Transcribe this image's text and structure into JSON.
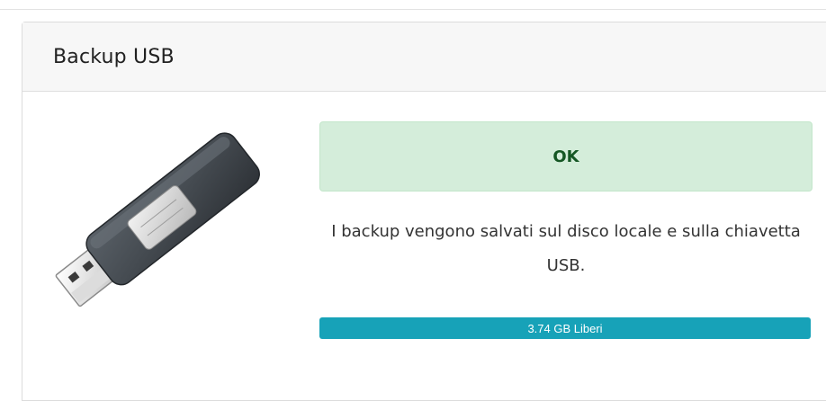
{
  "card": {
    "title": "Backup USB"
  },
  "device": {
    "icon": "usb-drive-icon"
  },
  "status": {
    "text": "OK",
    "color": "#d4edda",
    "text_color": "#155724"
  },
  "description": "I backup vengono salvati sul disco locale e sulla chiavetta USB.",
  "storage": {
    "label": "3.74 GB Liberi",
    "fill_percent": 100,
    "bar_color": "#17a2b8"
  }
}
